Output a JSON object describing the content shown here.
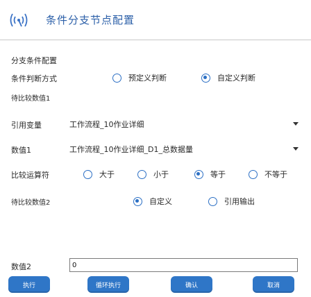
{
  "header": {
    "title": "条件分支节点配置",
    "logo_icon": "wifi-signal-logo-icon"
  },
  "section": {
    "title": "分支条件配置"
  },
  "condition_mode": {
    "label": "条件判断方式",
    "options": [
      {
        "label": "预定义判断",
        "selected": false
      },
      {
        "label": "自定义判断",
        "selected": true
      }
    ]
  },
  "compare_value_1": {
    "label": "待比较数值1"
  },
  "reference_var": {
    "label": "引用变量",
    "selected": "工作流程_10作业详细"
  },
  "value_1": {
    "label": "数值1",
    "selected": "工作流程_10作业详细_D1_总数据量"
  },
  "comparator": {
    "label": "比较运算符",
    "options": [
      {
        "label": "大于",
        "selected": false
      },
      {
        "label": "小于",
        "selected": false
      },
      {
        "label": "等于",
        "selected": true
      },
      {
        "label": "不等于",
        "selected": false
      }
    ]
  },
  "compare_value_2": {
    "label": "待比较数值2",
    "options": [
      {
        "label": "自定义",
        "selected": true
      },
      {
        "label": "引用输出",
        "selected": false
      }
    ]
  },
  "value_2": {
    "label": "数值2",
    "value": "0"
  },
  "buttons": {
    "execute": "执行",
    "loop_execute": "循环执行",
    "confirm": "确认",
    "cancel": "取消"
  },
  "colors": {
    "accent": "#2f76c7",
    "title": "#2b5fa8"
  }
}
